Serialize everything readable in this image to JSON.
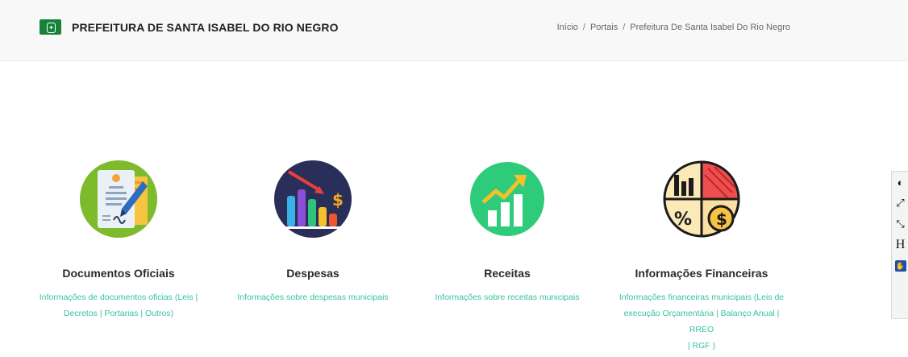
{
  "header": {
    "site_title": "PREFEITURA DE SANTA ISABEL DO RIO NEGRO",
    "breadcrumb": [
      "Início",
      "Portais",
      "Prefeitura De Santa Isabel Do Rio Negro"
    ],
    "flag_icon": "municipality-flag-icon"
  },
  "cards": [
    {
      "title": "Documentos Oficiais",
      "desc_lines": [
        "Informações de documentos oficias (Leis |",
        "Decretos | Portarias | Outros)"
      ],
      "icon": "document-signing-icon"
    },
    {
      "title": "Despesas",
      "desc_lines": [
        "Informações sobre despesas municipais"
      ],
      "icon": "falling-expenses-chart-icon"
    },
    {
      "title": "Receitas",
      "desc_lines": [
        "Informações sobre receitas municipais"
      ],
      "icon": "rising-revenue-chart-icon"
    },
    {
      "title": "Informações Financeiras",
      "desc_lines": [
        "Informações financeiras municipais (Leis de",
        "execução Orçamentária | Balanço Anual | RREO",
        "| RGF )"
      ],
      "icon": "financial-info-pie-icon"
    }
  ],
  "accessibility": {
    "contrast_icon": "contrast-icon",
    "increase_font_icon": "increase-font-icon",
    "decrease_font_icon": "decrease-font-icon",
    "h_label": "H",
    "libras_icon": "sign-language-icon"
  },
  "colors": {
    "accent": "#39c0a5",
    "flag_green": "#18823a"
  }
}
